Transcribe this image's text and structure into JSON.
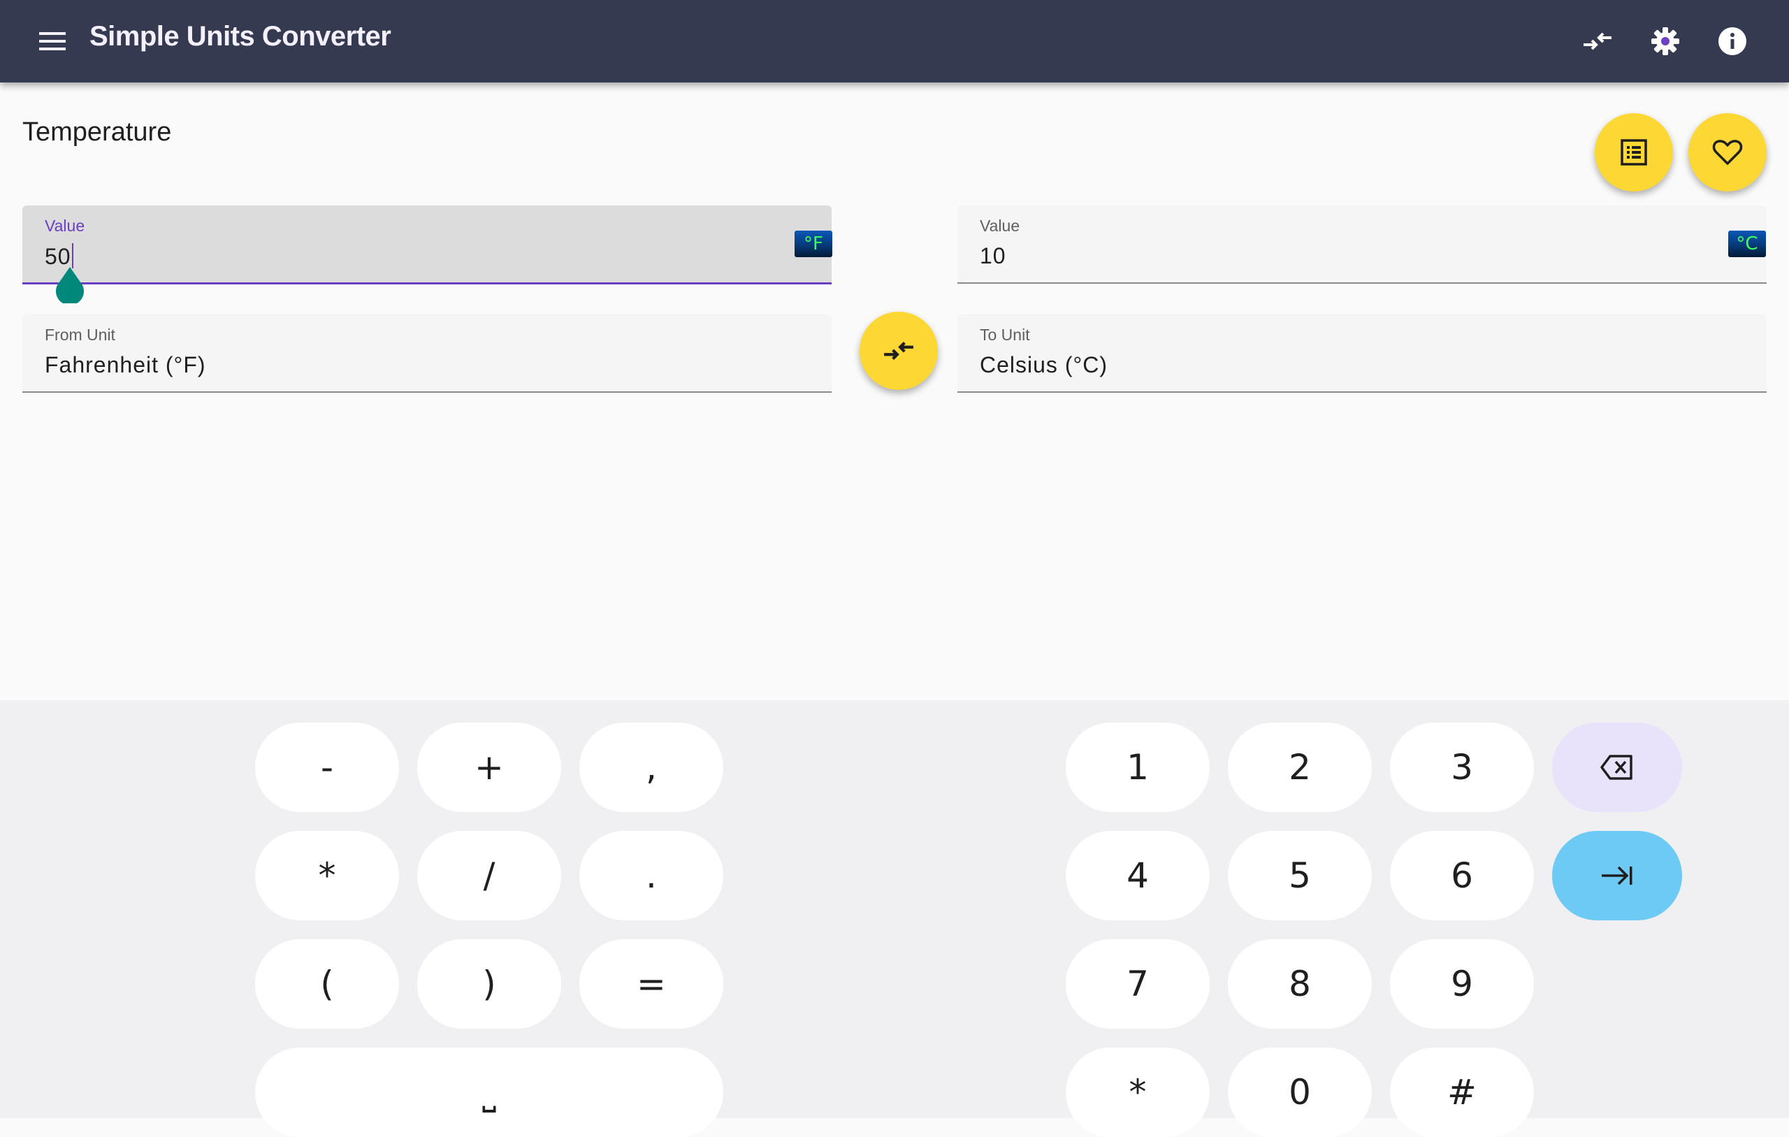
{
  "app": {
    "title": "Simple Units Converter"
  },
  "icons": {
    "menu": "menu-icon",
    "swap": "swap-icon",
    "settings": "gear-icon",
    "info": "info-icon",
    "list": "list-icon",
    "favorite": "heart-icon"
  },
  "page": {
    "title": "Temperature"
  },
  "from": {
    "label": "Value",
    "value": "50",
    "unit_label": "From Unit",
    "unit": "Fahrenheit (°F)",
    "badge": "°F"
  },
  "to": {
    "label": "Value",
    "value": "10",
    "unit_label": "To Unit",
    "unit": "Celsius (°C)",
    "badge": "°C"
  },
  "keyboard": {
    "left": [
      "-",
      "+",
      ",",
      "*",
      "/",
      ".",
      "(",
      ")",
      "="
    ],
    "space": "⎵",
    "numbers": [
      "1",
      "2",
      "3",
      "4",
      "5",
      "6",
      "7",
      "8",
      "9",
      "*",
      "0",
      "#"
    ]
  },
  "colors": {
    "appbar": "#353a50",
    "accent": "#fdd835",
    "focus": "#6a3fc4",
    "enter_key": "#6ccaf5",
    "delete_key": "#e8e2fb"
  }
}
